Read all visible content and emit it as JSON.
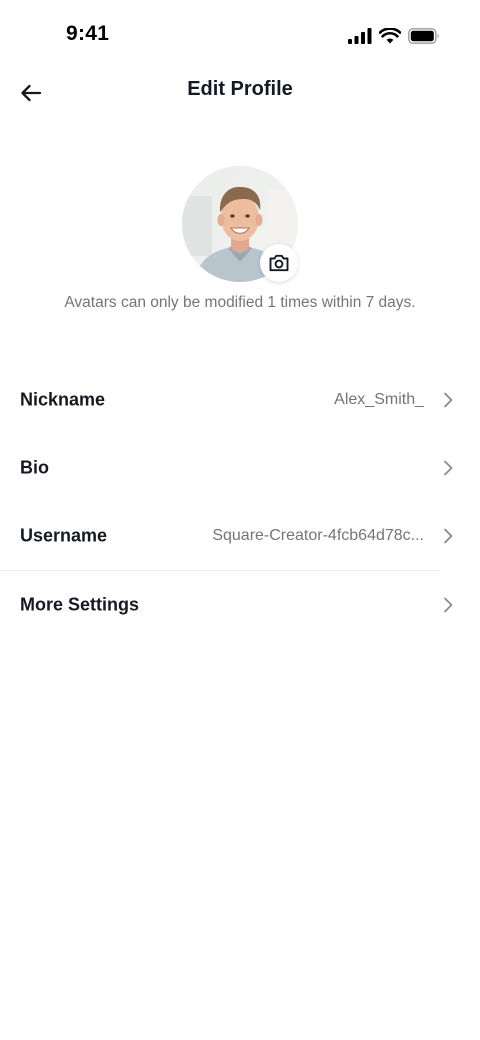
{
  "status_bar": {
    "time": "9:41",
    "icons": [
      "signal-icon",
      "wifi-icon",
      "battery-icon"
    ]
  },
  "header": {
    "title": "Edit Profile",
    "back_icon": "arrow-left-icon"
  },
  "avatar": {
    "camera_icon": "camera-icon",
    "note": "Avatars can only be modified 1 times within 7 days."
  },
  "rows": [
    {
      "label": "Nickname",
      "value": "Alex_Smith_"
    },
    {
      "label": "Bio",
      "value": ""
    },
    {
      "label": "Username",
      "value": "Square-Creator-4fcb64d78c..."
    },
    {
      "label": "More Settings",
      "value": ""
    }
  ],
  "colors": {
    "primary_text": "#161823",
    "secondary_text": "#757575",
    "chevron": "#8a8b91",
    "divider": "#ebebeb",
    "background": "#ffffff"
  }
}
